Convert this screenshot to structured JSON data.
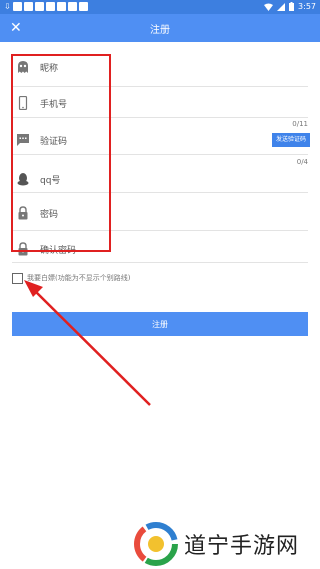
{
  "status_bar": {
    "time": "3:57",
    "download": "⇩"
  },
  "app_bar": {
    "title": "注册",
    "close": "✕"
  },
  "form": {
    "nickname": {
      "placeholder": "昵称"
    },
    "phone": {
      "placeholder": "手机号",
      "counter": "0/11"
    },
    "code": {
      "placeholder": "验证码",
      "send_button": "发送验证码"
    },
    "qq": {
      "placeholder": "qq号",
      "counter": "0/4"
    },
    "password": {
      "placeholder": "密码"
    },
    "confirm_password": {
      "placeholder": "确认密码"
    }
  },
  "checkbox_label": "我要白嫖(功能为不显示个别路线)",
  "submit_label": "注册",
  "watermark": "道宁手游网",
  "colors": {
    "primary": "#4f8ff3",
    "annotation": "#e02020"
  },
  "icons": [
    "ghost-icon",
    "phone-icon",
    "message-icon",
    "qq-icon",
    "lock-icon"
  ]
}
